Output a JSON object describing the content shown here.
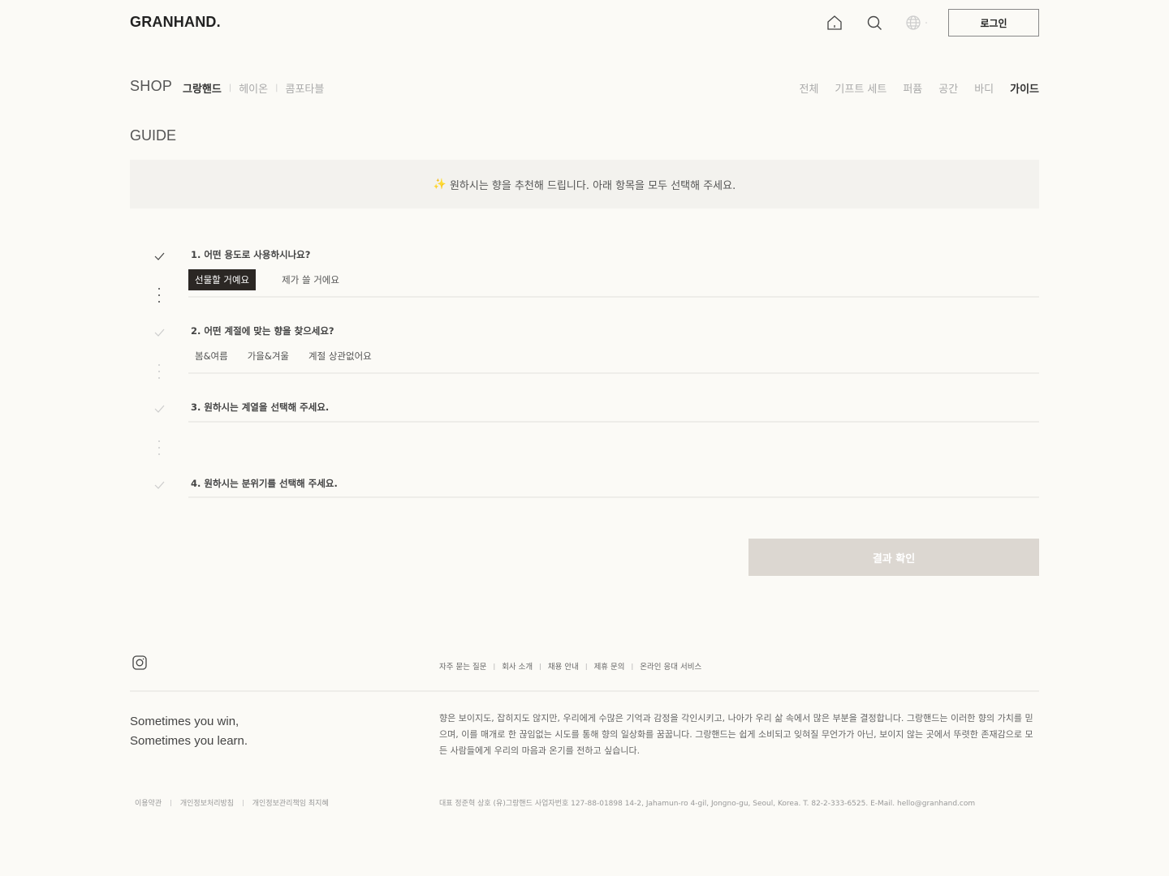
{
  "header": {
    "logo": "GRANHAND.",
    "login_label": "로그인",
    "icons": [
      "home-icon",
      "search-icon",
      "globe-icon"
    ]
  },
  "shop_nav": {
    "title": "SHOP",
    "brands": [
      {
        "label": "그랑핸드",
        "active": true
      },
      {
        "label": "헤이온",
        "active": false
      },
      {
        "label": "콤포타블",
        "active": false
      }
    ],
    "categories": [
      {
        "label": "전체",
        "active": false
      },
      {
        "label": "기프트 세트",
        "active": false
      },
      {
        "label": "퍼퓸",
        "active": false
      },
      {
        "label": "공간",
        "active": false
      },
      {
        "label": "바디",
        "active": false
      },
      {
        "label": "가이드",
        "active": true
      }
    ]
  },
  "guide": {
    "title": "GUIDE",
    "banner_icon": "✨",
    "banner_text": "원하시는 향을 추천해 드립니다. 아래 항목을 모두 선택해 주세요.",
    "questions": [
      {
        "label": "1. 어떤 용도로 사용하시나요?",
        "options": [
          "선물할 거예요",
          "제가 쓸 거에요"
        ],
        "selected": "선물할 거예요"
      },
      {
        "label": "2. 어떤 계절에 맞는 향을 찾으세요?",
        "options": [
          "봄&여름",
          "가을&겨울",
          "계절 상관없어요"
        ],
        "selected": null
      },
      {
        "label": "3. 원하시는 계열을 선택해 주세요.",
        "options": [],
        "selected": null
      },
      {
        "label": "4. 원하시는 분위기를 선택해 주세요.",
        "options": [],
        "selected": null
      }
    ],
    "result_label": "결과 확인"
  },
  "footer": {
    "links": [
      "자주 묻는 질문",
      "회사 소개",
      "채용 안내",
      "제휴 문의",
      "온라인 응대 서비스"
    ],
    "slogan_line1": "Sometimes you win,",
    "slogan_line2": "Sometimes you learn.",
    "about": "향은 보이지도, 잡히지도 않지만, 우리에게 수많은 기억과 감정을 각인시키고, 나아가 우리 삶 속에서 많은 부분을 결정합니다. 그랑핸드는 이러한 향의 가치를 믿으며, 이를 매개로 한 끊임없는 시도를 통해 향의 일상화를 꿈꿉니다. 그랑핸드는 쉽게 소비되고 잊혀질 무언가가 아닌, 보이지 않는 곳에서 뚜렷한 존재감으로 모든 사람들에게 우리의 마음과 온기를 전하고 싶습니다.",
    "legal_links": [
      "이용약관",
      "개인정보처리방침",
      "개인정보관리책임 최지혜"
    ],
    "company_info": "대표 정준혁 상호 (유)그랑핸드 사업자번호 127-88-01898 14-2, Jahamun-ro 4-gil, Jongno-gu, Seoul, Korea. T.  82-2-333-6525. E-Mail. hello@granhand.com"
  },
  "colors": {
    "background": "#fbfaf6",
    "selected_option": "#2b2724",
    "result_button": "#dcd7d1",
    "banner_bg": "#f3f2ee"
  }
}
